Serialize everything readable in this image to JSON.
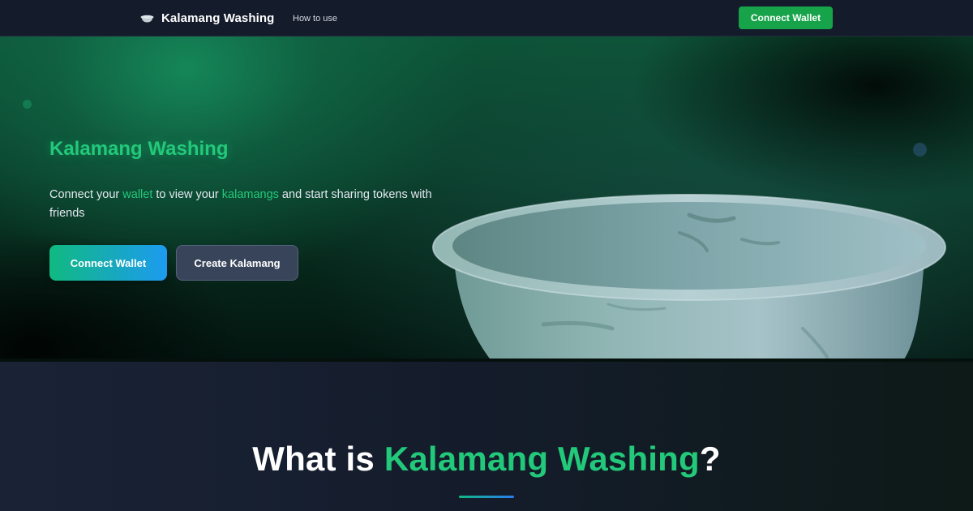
{
  "navbar": {
    "brand_icon": "bowl-icon",
    "brand_title": "Kalamang Washing",
    "links": [
      {
        "label": "How to use"
      }
    ],
    "connect_label": "Connect Wallet",
    "connect_color": "#16a34a"
  },
  "hero": {
    "title": "Kalamang Washing",
    "description": {
      "part1": "Connect your ",
      "highlight1": "wallet",
      "part2": " to view your ",
      "highlight2": "kalamangs",
      "part3": " and start sharing tokens with friends"
    },
    "primary_button": "Connect Wallet",
    "secondary_button": "Create Kalamang",
    "image": "metal-washing-bowl",
    "accent_color": "#22c97a"
  },
  "about": {
    "title_prefix": "What is ",
    "title_accent": "Kalamang Washing",
    "title_suffix": "?"
  }
}
